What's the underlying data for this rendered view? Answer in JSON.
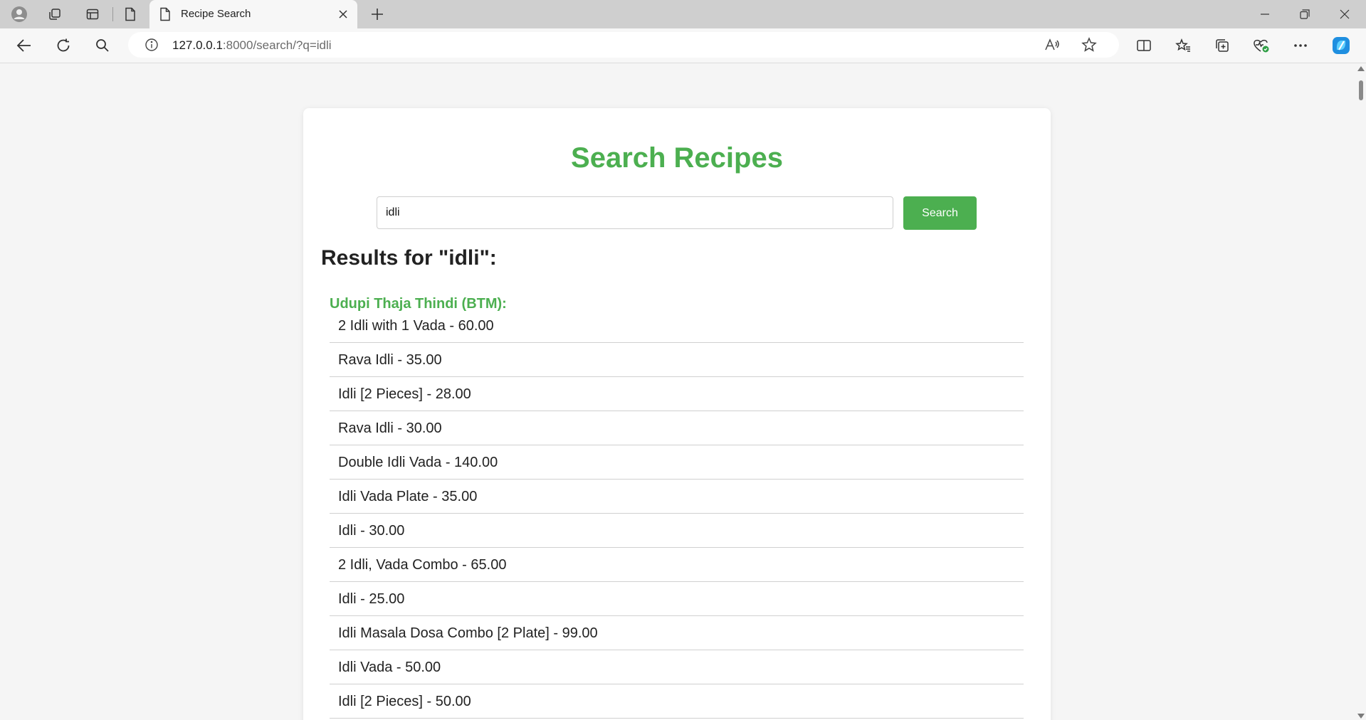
{
  "browser": {
    "tab_title": "Recipe Search",
    "url_host": "127.0.0.1",
    "url_rest": ":8000/search/?q=idli"
  },
  "page": {
    "title": "Search Recipes",
    "search": {
      "value": "idli",
      "button_label": "Search"
    },
    "results_heading": "Results for \"idli\":",
    "restaurants": [
      {
        "name": "Udupi Thaja Thindi (BTM):",
        "items": [
          "2 Idli with 1 Vada - 60.00",
          "Rava Idli - 35.00",
          "Idli [2 Pieces] - 28.00",
          "Rava Idli - 30.00",
          "Double Idli Vada - 140.00",
          "Idli Vada Plate - 35.00",
          "Idli - 30.00",
          "2 Idli, Vada Combo - 65.00",
          "Idli - 25.00",
          "Idli Masala Dosa Combo [2 Plate] - 99.00",
          "Idli Vada - 50.00",
          "Idli [2 Pieces] - 50.00"
        ]
      }
    ]
  },
  "colors": {
    "accent": "#4caf50",
    "tabbar": "#cfcfcf",
    "page_bg": "#f5f5f5"
  }
}
